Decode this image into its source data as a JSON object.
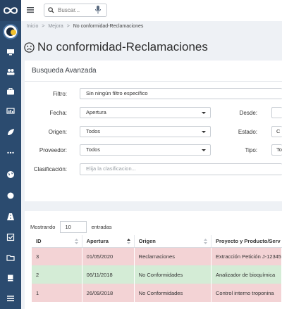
{
  "topbar": {
    "search_placeholder": "Buscar..."
  },
  "breadcrumb": [
    "Inicio",
    ">",
    "Mejora",
    ">",
    "No conformidad-Reclamaciones"
  ],
  "page_title": "No conformidad-Reclamaciones",
  "panel": {
    "title": "Busqueda Avanzada",
    "filters": {
      "filtro_label": "Filtro:",
      "filtro_value": "Sin ningún filtro específico",
      "fecha_label": "Fecha:",
      "fecha_value": "Apertura",
      "desde_label": "Desde:",
      "origen_label": "Origen:",
      "origen_value": "Todos",
      "estado_label": "Estado:",
      "estado_value": "C",
      "proveedor_label": "Proveedor:",
      "proveedor_value": "Todos",
      "tipo_label": "Tipo:",
      "tipo_value": "To",
      "clasificacion_label": "Clasificación:",
      "clasificacion_placeholder": "Elija la clasificacion..."
    }
  },
  "table": {
    "show_label": "Mostrando",
    "page_size": "10",
    "entries_label": "entradas",
    "columns": [
      "ID",
      "Apertura",
      "Origen",
      "Proyecto y Producto/Serv"
    ],
    "rows": [
      {
        "id": "3",
        "apertura": "01/05/2020",
        "origen": "Reclamaciones",
        "proyecto": "Extracción Petición J-12345",
        "status": "red"
      },
      {
        "id": "2",
        "apertura": "06/11/2018",
        "origen": "No Conformidades",
        "proyecto": "Analizador de bioquímica",
        "status": "green"
      },
      {
        "id": "1",
        "apertura": "26/09/2018",
        "origen": "No Conformidades",
        "proyecto": "Control interno troponina",
        "status": "red"
      }
    ]
  },
  "colors": {
    "sidebar": "#2b4b6f",
    "row_red": "#f3d3d5",
    "row_green": "#d4ecd6"
  }
}
